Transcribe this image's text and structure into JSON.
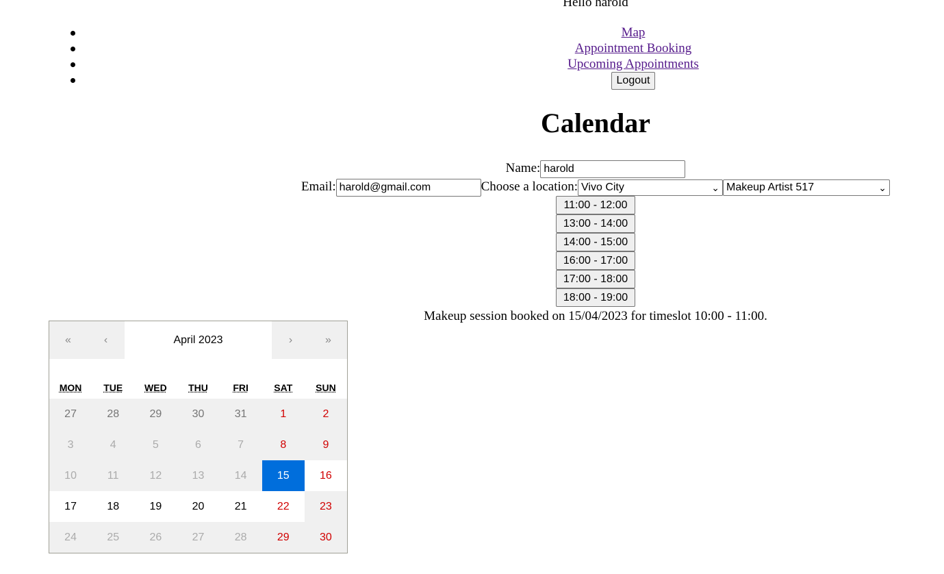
{
  "header": {
    "greeting": "Hello harold",
    "nav": [
      "Map",
      "Appointment Booking",
      "Upcoming Appointments"
    ],
    "logout_label": "Logout"
  },
  "page_title": "Calendar",
  "form": {
    "name_label": "Name:",
    "name_value": "harold",
    "email_label": "Email:",
    "email_value": "harold@gmail.com",
    "location_label": "Choose a location:",
    "location_selected": "Vivo City",
    "artist_selected": "Makeup Artist 517",
    "timeslots": [
      "11:00 - 12:00",
      "13:00 - 14:00",
      "14:00 - 15:00",
      "16:00 - 17:00",
      "17:00 - 18:00",
      "18:00 - 19:00"
    ],
    "booking_message": "Makeup session booked on 15/04/2023 for timeslot 10:00 - 11:00."
  },
  "calendar": {
    "month_label": "April 2023",
    "nav": {
      "prev2": "«",
      "prev": "‹",
      "next": "›",
      "next2": "»"
    },
    "weekdays": [
      "MON",
      "TUE",
      "WED",
      "THU",
      "FRI",
      "SAT",
      "SUN"
    ],
    "days": [
      {
        "n": "27",
        "state": "neighbor"
      },
      {
        "n": "28",
        "state": "neighbor"
      },
      {
        "n": "29",
        "state": "neighbor"
      },
      {
        "n": "30",
        "state": "neighbor"
      },
      {
        "n": "31",
        "state": "neighbor"
      },
      {
        "n": "1",
        "state": "weekend"
      },
      {
        "n": "2",
        "state": "weekend"
      },
      {
        "n": "3",
        "state": "disabled"
      },
      {
        "n": "4",
        "state": "disabled"
      },
      {
        "n": "5",
        "state": "disabled"
      },
      {
        "n": "6",
        "state": "disabled"
      },
      {
        "n": "7",
        "state": "disabled"
      },
      {
        "n": "8",
        "state": "weekend"
      },
      {
        "n": "9",
        "state": "weekend"
      },
      {
        "n": "10",
        "state": "disabled"
      },
      {
        "n": "11",
        "state": "disabled"
      },
      {
        "n": "12",
        "state": "disabled"
      },
      {
        "n": "13",
        "state": "disabled"
      },
      {
        "n": "14",
        "state": "disabled"
      },
      {
        "n": "15",
        "state": "selected"
      },
      {
        "n": "16",
        "state": "active-weekend"
      },
      {
        "n": "17",
        "state": "active"
      },
      {
        "n": "18",
        "state": "active"
      },
      {
        "n": "19",
        "state": "active"
      },
      {
        "n": "20",
        "state": "active"
      },
      {
        "n": "21",
        "state": "active"
      },
      {
        "n": "22",
        "state": "active-weekend"
      },
      {
        "n": "23",
        "state": "weekend"
      },
      {
        "n": "24",
        "state": "disabled"
      },
      {
        "n": "25",
        "state": "disabled"
      },
      {
        "n": "26",
        "state": "disabled"
      },
      {
        "n": "27",
        "state": "disabled"
      },
      {
        "n": "28",
        "state": "disabled"
      },
      {
        "n": "29",
        "state": "weekend"
      },
      {
        "n": "30",
        "state": "weekend"
      }
    ]
  },
  "colors": {
    "link": "#551a8b",
    "selected_day": "#006edc",
    "weekend": "#d10000",
    "tile_bg": "#f0f0f0"
  }
}
